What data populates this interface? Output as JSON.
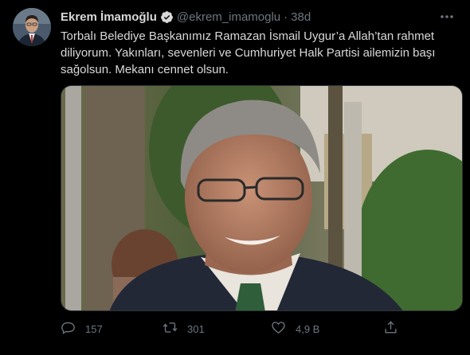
{
  "tweet": {
    "author": {
      "display_name": "Ekrem İmamoğlu",
      "handle": "@ekrem_imamoglu",
      "verified": true
    },
    "separator": "·",
    "timestamp": "38d",
    "text_lines": [
      "Torbalı Belediye Başkanımız Ramazan İsmail Uygur’a Allah’tan rahmet",
      "diliyorum. Yakınları, sevenleri ve Cumhuriyet Halk Partisi ailemizin başı",
      "sağolsun. Mekanı cennet olsun."
    ],
    "actions": {
      "reply_count": "157",
      "retweet_count": "301",
      "like_count": "4,9 B"
    }
  },
  "icons": {
    "verified": "verified-badge-icon",
    "more": "more-options-icon",
    "reply": "reply-icon",
    "retweet": "retweet-icon",
    "like": "heart-icon",
    "share": "share-icon"
  },
  "colors": {
    "background": "#000000",
    "text": "#d9d9d9",
    "secondary_text": "#6e767d",
    "verified_badge": "#d9d9d9"
  }
}
